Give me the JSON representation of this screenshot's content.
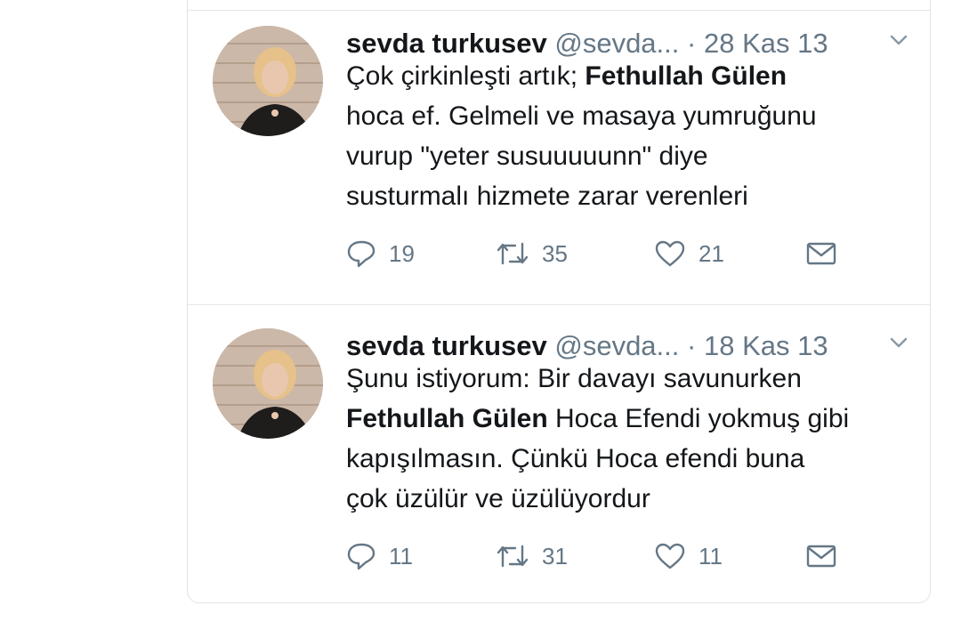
{
  "tweets": [
    {
      "author_name": "sevda turkusev",
      "handle": "@sevda...",
      "separator": "·",
      "date": "28 Kas 13",
      "lines": [
        {
          "a": "Çok çirkinleşti artık; ",
          "b": "Fethullah Gülen",
          "c": ""
        },
        {
          "a": "hoca ef. Gelmeli ve masaya yumruğunu",
          "b": "",
          "c": ""
        },
        {
          "a": "vurup \"yeter susuuuuunn\" diye",
          "b": "",
          "c": ""
        },
        {
          "a": "susturmalı hizmete zarar verenleri",
          "b": "",
          "c": ""
        }
      ],
      "counts": {
        "reply": "19",
        "retweet": "35",
        "like": "21"
      }
    },
    {
      "author_name": "sevda turkusev",
      "handle": "@sevda...",
      "separator": "·",
      "date": "18 Kas 13",
      "lines": [
        {
          "a": "Şunu istiyorum: Bir davayı savunurken",
          "b": "",
          "c": ""
        },
        {
          "a": "",
          "b": "Fethullah Gülen",
          "c": " Hoca Efendi yokmuş gibi"
        },
        {
          "a": "kapışılmasın. Çünkü Hoca efendi buna",
          "b": "",
          "c": ""
        },
        {
          "a": "çok üzülür ve üzülüyordur",
          "b": "",
          "c": ""
        }
      ],
      "counts": {
        "reply": "11",
        "retweet": "31",
        "like": "11"
      }
    }
  ],
  "colors": {
    "text": "#14171a",
    "secondary": "#657786",
    "border": "#e3e7eb"
  },
  "icons": [
    "chevron-down-icon",
    "reply-icon",
    "retweet-icon",
    "like-icon",
    "message-icon"
  ]
}
